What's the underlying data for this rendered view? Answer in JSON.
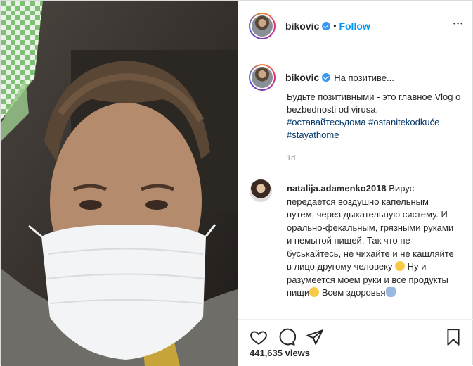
{
  "post": {
    "username": "bikovic",
    "follow_label": "Follow",
    "dot": "•",
    "more_label": "• • •"
  },
  "caption": {
    "username": "bikovic",
    "title": "На позитиве...",
    "body": "Будьте позитивными - это главное Vlog o bezbednosti od virusa.",
    "hashtags": [
      "#оставайтесьдома",
      "#ostanitekodkuće",
      "#stayathome"
    ],
    "time": "1d"
  },
  "comment": {
    "username": "natalija.adamenko2018",
    "text_part1": "Вирус передается воздушно капельным путем, через дыхательную систему. И орально-фекальным, грязными руками и немытой пищей. Так что не буськайтесь, не чихайте и не кашляйте в лицо другому человеку",
    "text_part2": "Ну и разумеется моем руки и все продукты пищи",
    "text_part3": "Всем здоровья"
  },
  "actions": {
    "views": "441,635 views",
    "icons": [
      "heart-icon",
      "comment-icon",
      "share-icon",
      "bookmark-icon"
    ]
  },
  "colors": {
    "link": "#0095f6",
    "hashtag": "#00376b",
    "meta": "#8e8e8e"
  }
}
